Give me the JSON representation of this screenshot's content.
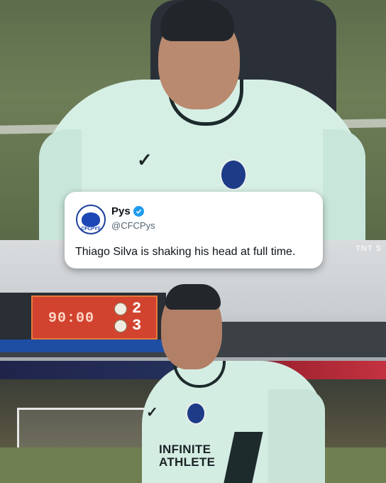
{
  "tweet": {
    "display_name": "Pys",
    "handle": "@CFCPys",
    "avatar_text": "CFCPYS",
    "verified_icon": "verified-badge-icon",
    "text": "Thiago Silva is shaking his head at full time."
  },
  "broadcast": {
    "watermark": "TNT S"
  },
  "scoreboard": {
    "clock": "90:00",
    "home_score": "2",
    "away_score": "3"
  },
  "kit": {
    "sponsor_line1": "INFINITE",
    "sponsor_line2": "ATHLETE"
  },
  "colors": {
    "verified": "#1d9bf0",
    "card_bg": "#ffffff",
    "scoreboard": "#d2432f",
    "kit": "#d6efe5"
  }
}
